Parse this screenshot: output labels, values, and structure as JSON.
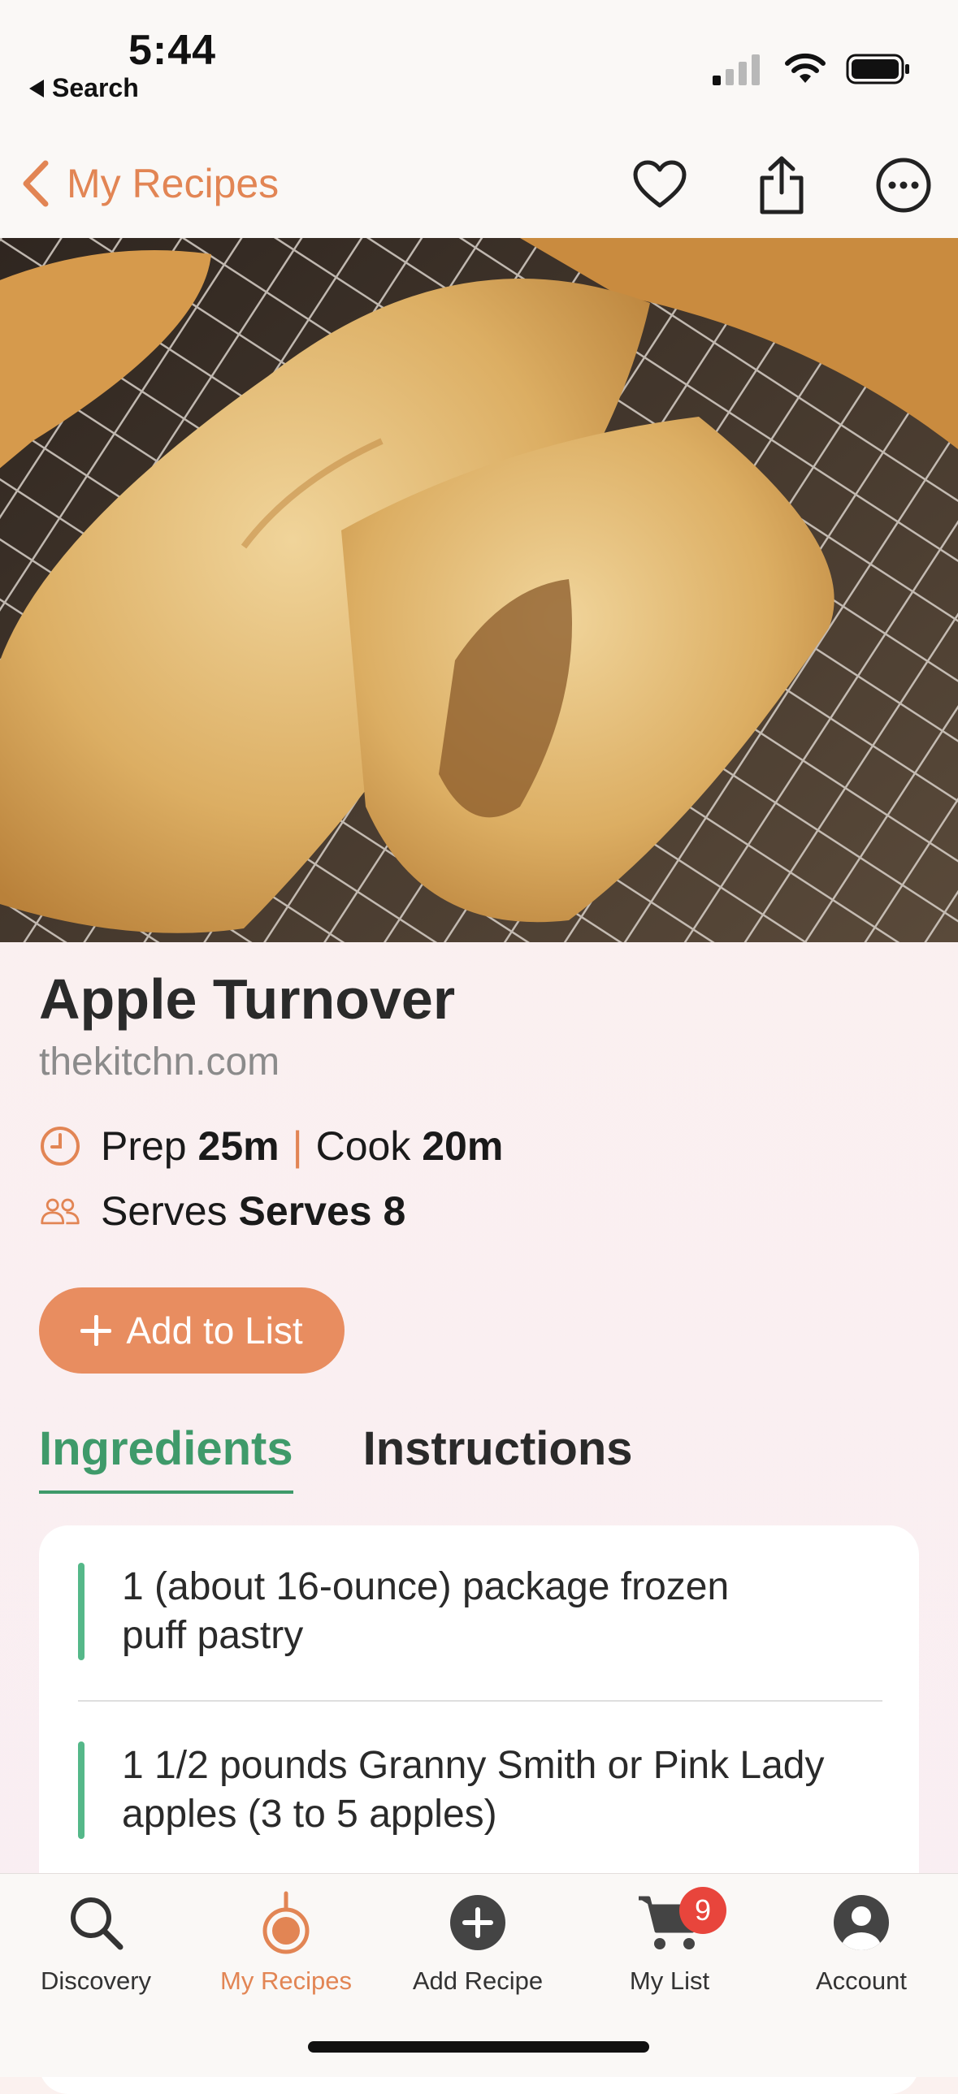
{
  "status_bar": {
    "time": "5:44",
    "back_label": "Search"
  },
  "nav": {
    "back_label": "My Recipes",
    "actions": [
      "heart-icon",
      "share-icon",
      "more-icon"
    ]
  },
  "recipe": {
    "title": "Apple Turnover",
    "source": "thekitchn.com",
    "prep_label": "Prep",
    "prep_value": "25m",
    "separator": "|",
    "cook_label": "Cook",
    "cook_value": "20m",
    "serves_label": "Serves",
    "serves_value": "Serves 8",
    "add_button": "Add to List"
  },
  "tabs": {
    "ingredients": "Ingredients",
    "instructions": "Instructions",
    "active": "ingredients"
  },
  "ingredients": [
    {
      "line1": "1 (about 16-ounce) package frozen",
      "line2": "puff pastry"
    },
    {
      "line1": "1 1/2 pounds Granny Smith or Pink Lady",
      "line2": "apples (3 to 5 apples)"
    }
  ],
  "tabbar": {
    "items": [
      {
        "label": "Discovery",
        "icon": "search-icon"
      },
      {
        "label": "My Recipes",
        "icon": "pot-icon"
      },
      {
        "label": "Add Recipe",
        "icon": "plus-circle-icon"
      },
      {
        "label": "My List",
        "icon": "cart-icon",
        "badge": "9"
      },
      {
        "label": "Account",
        "icon": "person-icon"
      }
    ],
    "active": "My Recipes"
  },
  "colors": {
    "accent": "#e28554",
    "green": "#3f9a6a",
    "badge": "#e8453c"
  }
}
